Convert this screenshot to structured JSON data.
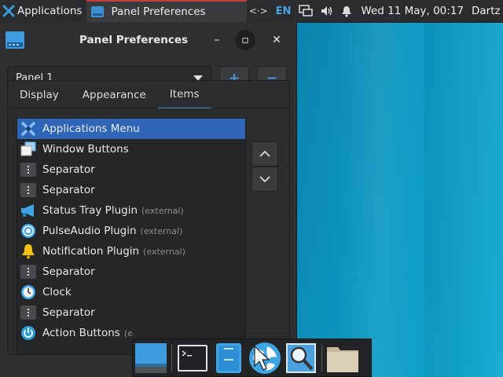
{
  "top_panel": {
    "applications_label": "Applications",
    "task_label": "Panel Preferences",
    "tray": {
      "arrows_icon": "<·>",
      "language": "EN",
      "clock": "Wed 11 May, 00:17",
      "user": "Dartz"
    }
  },
  "window": {
    "title": "Panel Preferences",
    "controls": {
      "minimize": "–",
      "maximize": "▫",
      "close": "✕"
    },
    "panel_select": "Panel 1",
    "add_label": "+",
    "remove_label": "−",
    "tabs": [
      {
        "label": "Display"
      },
      {
        "label": "Appearance"
      },
      {
        "label": "Items"
      }
    ],
    "active_tab": "Items",
    "items": [
      {
        "label": "Applications Menu",
        "note": "",
        "icon": "xfce-menu-icon"
      },
      {
        "label": "Window Buttons",
        "note": "",
        "icon": "windows-icon"
      },
      {
        "label": "Separator",
        "note": "",
        "icon": "separator-icon"
      },
      {
        "label": "Separator",
        "note": "",
        "icon": "separator-icon"
      },
      {
        "label": "Status Tray Plugin",
        "note": "(external)",
        "icon": "megaphone-icon"
      },
      {
        "label": "PulseAudio Plugin",
        "note": "(external)",
        "icon": "audio-icon"
      },
      {
        "label": "Notification Plugin",
        "note": "(external)",
        "icon": "bell-icon"
      },
      {
        "label": "Separator",
        "note": "",
        "icon": "separator-icon"
      },
      {
        "label": "Clock",
        "note": "",
        "icon": "clock-icon"
      },
      {
        "label": "Separator",
        "note": "",
        "icon": "separator-icon"
      },
      {
        "label": "Action Buttons",
        "note": "(e",
        "icon": "power-icon"
      }
    ]
  },
  "dock": {
    "items": [
      "desktop-icon",
      "terminal-icon",
      "file-manager-icon",
      "web-browser-icon",
      "app-finder-icon",
      "folder-icon"
    ]
  },
  "colors": {
    "selection": "#2f65b6",
    "accent": "#4a90d9",
    "task_highlight": "#c23a3a"
  }
}
